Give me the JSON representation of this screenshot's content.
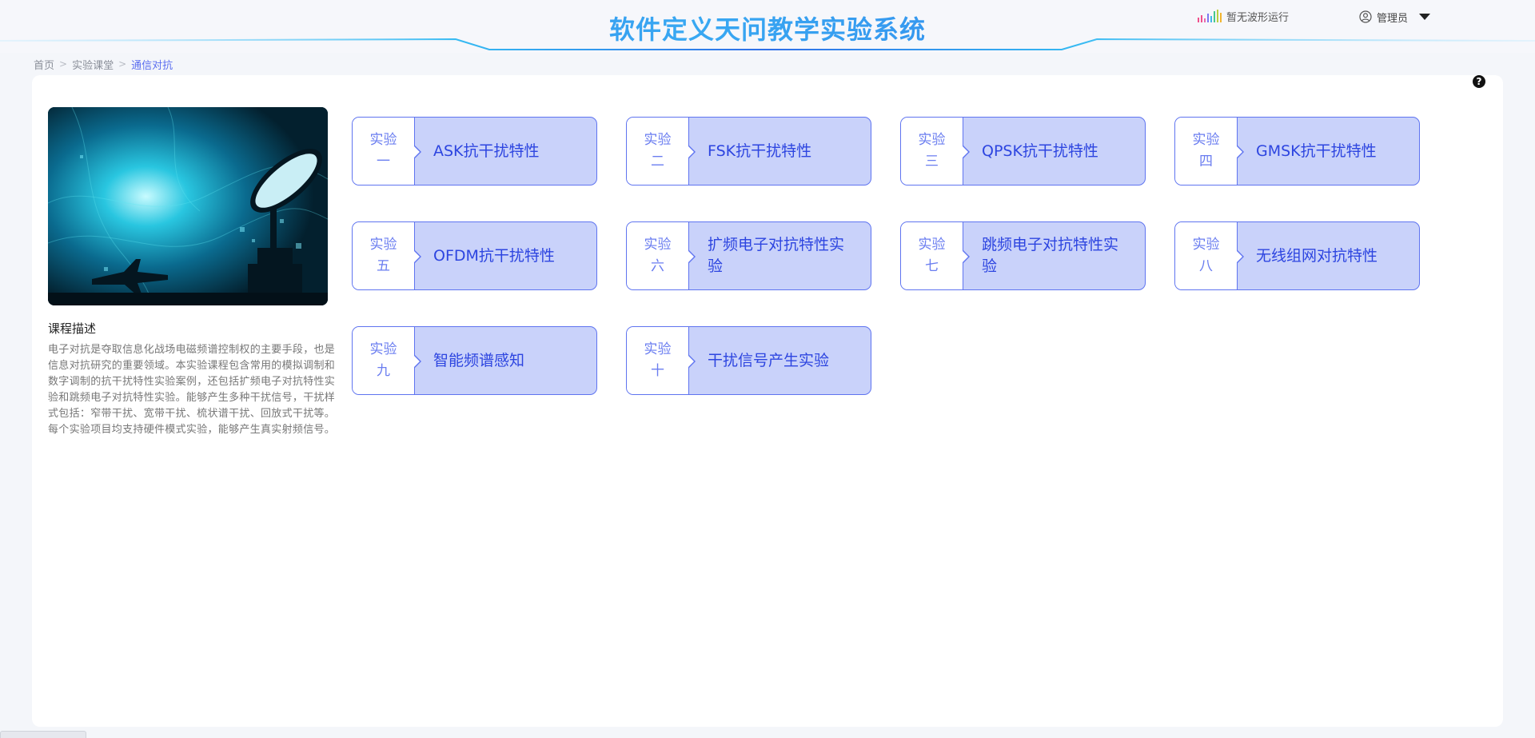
{
  "header": {
    "title": "软件定义天问教学实验系统",
    "status_text": "暂无波形运行",
    "user_label": "管理员"
  },
  "breadcrumb": [
    "首页",
    "实验课堂",
    "通信对抗"
  ],
  "course": {
    "desc_title": "课程描述",
    "desc_text": "电子对抗是夺取信息化战场电磁频谱控制权的主要手段，也是信息对抗研究的重要领域。本实验课程包含常用的模拟调制和数字调制的抗干扰特性实验案例，还包括扩频电子对抗特性实验和跳频电子对抗特性实验。能够产生多种干扰信号，干扰样式包括：窄带干扰、宽带干扰、梳状谱干扰、回放式干扰等。每个实验项目均支持硬件模式实验，能够产生真实射频信号。"
  },
  "experiments": [
    {
      "tag_top": "实验",
      "tag_bottom": "一",
      "title": "ASK抗干扰特性"
    },
    {
      "tag_top": "实验",
      "tag_bottom": "二",
      "title": "FSK抗干扰特性"
    },
    {
      "tag_top": "实验",
      "tag_bottom": "三",
      "title": "QPSK抗干扰特性"
    },
    {
      "tag_top": "实验",
      "tag_bottom": "四",
      "title": "GMSK抗干扰特性"
    },
    {
      "tag_top": "实验",
      "tag_bottom": "五",
      "title": "OFDM抗干扰特性"
    },
    {
      "tag_top": "实验",
      "tag_bottom": "六",
      "title": "扩频电子对抗特性实验"
    },
    {
      "tag_top": "实验",
      "tag_bottom": "七",
      "title": "跳频电子对抗特性实验"
    },
    {
      "tag_top": "实验",
      "tag_bottom": "八",
      "title": "无线组网对抗特性"
    },
    {
      "tag_top": "实验",
      "tag_bottom": "九",
      "title": "智能频谱感知"
    },
    {
      "tag_top": "实验",
      "tag_bottom": "十",
      "title": "干扰信号产生实验"
    }
  ],
  "colors": {
    "accent": "#5f74f0",
    "card_fill": "#c9d2fa",
    "title_blue": "#2f7de8"
  },
  "icons": {
    "status": "waveform-icon",
    "user": "user-circle-icon",
    "dropdown": "caret-down-icon",
    "help": "help-circle-icon"
  }
}
